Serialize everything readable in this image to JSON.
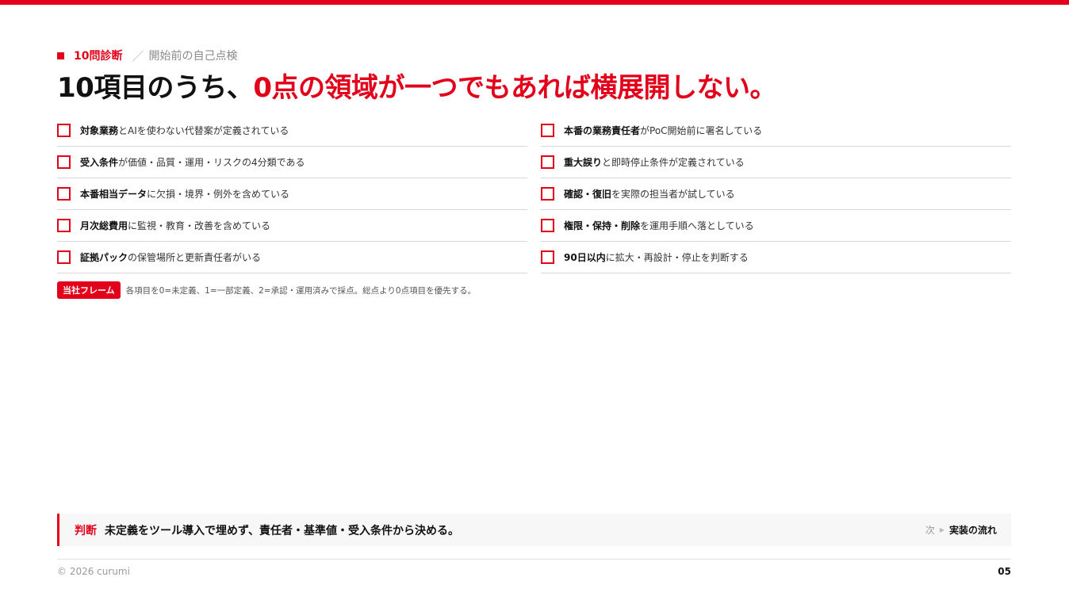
{
  "eyebrow": {
    "tag": "10問診断",
    "separator": "／",
    "subtitle": "開始前の自己点検"
  },
  "title": {
    "prefix": "10項目のうち、",
    "highlight": "0点の領域が一つでもあれば横展開しない。"
  },
  "checklist": {
    "left": [
      {
        "bold": "対象業務",
        "rest": "とAIを使わない代替案が定義されている"
      },
      {
        "bold": "受入条件",
        "rest": "が価値・品質・運用・リスクの4分類である"
      },
      {
        "bold": "本番相当データ",
        "rest": "に欠損・境界・例外を含めている"
      },
      {
        "bold": "月次総費用",
        "rest": "に監視・教育・改善を含めている"
      },
      {
        "bold": "証拠パック",
        "rest": "の保管場所と更新責任者がいる"
      }
    ],
    "right": [
      {
        "bold": "本番の業務責任者",
        "rest": "がPoC開始前に署名している"
      },
      {
        "bold": "重大誤り",
        "rest": "と即時停止条件が定義されている"
      },
      {
        "bold": "確認・復旧",
        "rest": "を実際の担当者が試している"
      },
      {
        "bold": "権限・保持・削除",
        "rest": "を運用手順へ落としている"
      },
      {
        "bold": "90日以内",
        "rest": "に拡大・再設計・停止を判断する"
      }
    ]
  },
  "note": {
    "badge": "当社フレーム",
    "text": "各項目を0=未定義、1=一部定義、2=承認・運用済みで採点。総点より0点項目を優先する。"
  },
  "verdict": {
    "label": "判断",
    "text": "未定義をツール導入で埋めず、責任者・基準値・受入条件から決める。",
    "next_label": "次",
    "next_text": "実装の流れ"
  },
  "footer": {
    "copyright": "© 2026 curumi",
    "page": "05"
  },
  "colors": {
    "accent": "#e2001a",
    "text": "#111111",
    "muted": "#8a8a8a"
  }
}
